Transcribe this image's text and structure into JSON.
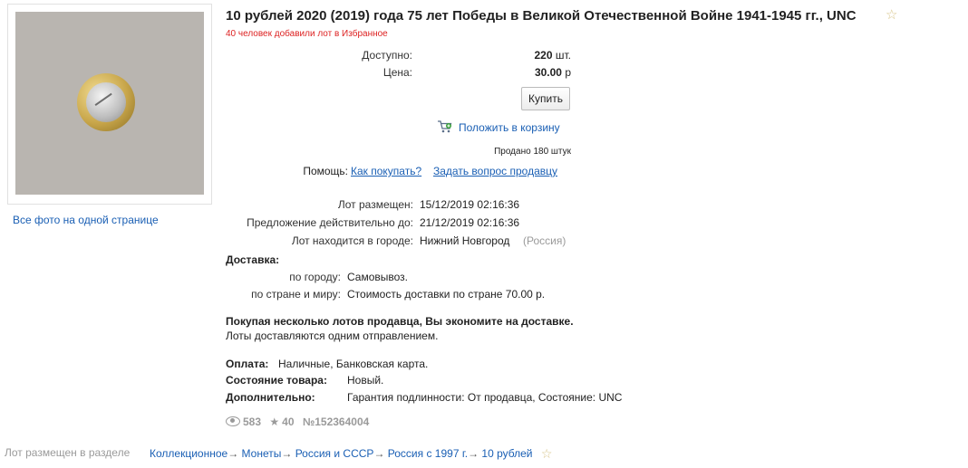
{
  "title": "10 рублей 2020 (2019) года 75 лет Победы в Великой Отечественной Войне 1941-1945 гг., UNC",
  "favorites_note": "40 человек добавили лот в Избранное",
  "photo": {
    "all_photos_link": "Все фото на одной странице"
  },
  "availability": {
    "label": "Доступно:",
    "value": "220",
    "unit": "шт."
  },
  "price": {
    "label": "Цена:",
    "value": "30.00",
    "currency": "р"
  },
  "buy_label": "Купить",
  "cart_link": "Положить в корзину",
  "sold_text": "Продано 180 штук",
  "help": {
    "label": "Помощь:",
    "how_to_buy": "Как покупать?",
    "ask_seller": "Задать вопрос продавцу"
  },
  "details": {
    "posted_label": "Лот размещен:",
    "posted_value": "15/12/2019 02:16:36",
    "valid_label": "Предложение действительно до:",
    "valid_value": "21/12/2019 02:16:36",
    "city_label": "Лот находится в городе:",
    "city_value": "Нижний Новгород",
    "country_value": "(Россия)"
  },
  "delivery": {
    "heading": "Доставка:",
    "city_label": "по городу:",
    "city_value": "Самовывоз.",
    "world_label": "по стране и миру:",
    "world_value": "Стоимость доставки по стране 70.00 р."
  },
  "shipping_note": {
    "bold": "Покупая несколько лотов продавца, Вы экономите на доставке.",
    "normal": "Лоты доставляются одним отправлением."
  },
  "payment": {
    "label": "Оплата:",
    "value": "Наличные, Банковская карта."
  },
  "condition": {
    "label": "Состояние товара:",
    "value": "Новый."
  },
  "extra": {
    "label": "Дополнительно:",
    "value": "Гарантия подлинности: От продавца, Состояние: UNC"
  },
  "stats": {
    "views": "583",
    "favorites": "40",
    "lot_number": "№152364004"
  },
  "category": {
    "label": "Лот размещен в разделе",
    "crumbs": [
      "Коллекционное",
      "Монеты",
      "Россия и СССР",
      "Россия с 1997 г.",
      "10 рублей"
    ],
    "arrow": "→"
  },
  "colors": {
    "link": "#1a5fb4",
    "favorites_note": "#dd2222",
    "muted": "#9a9a9a"
  },
  "icons": {
    "cart": "cart-add-icon",
    "favorite": "star-outline-icon",
    "views": "eye-icon"
  }
}
